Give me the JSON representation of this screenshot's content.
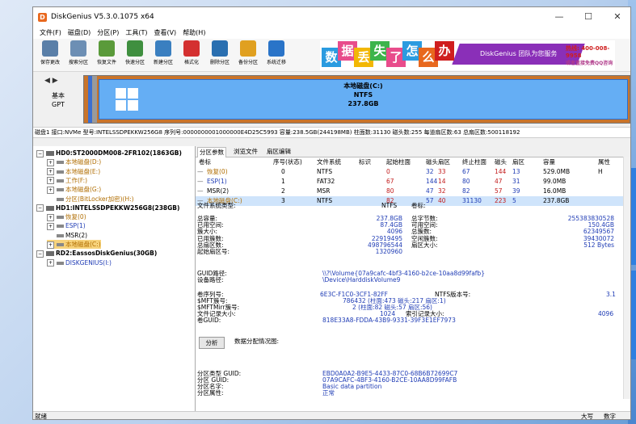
{
  "window": {
    "title": "DiskGenius V5.3.0.1075 x64",
    "minimize": "—",
    "maximize": "☐",
    "close": "✕"
  },
  "menu": [
    "文件(F)",
    "磁盘(D)",
    "分区(P)",
    "工具(T)",
    "查看(V)",
    "帮助(H)"
  ],
  "toolbar": [
    {
      "label": "保存更改",
      "icon": "save-icon",
      "color": "#5a7fa8"
    },
    {
      "label": "搜索分区",
      "icon": "search-icon",
      "color": "#6d8fb4"
    },
    {
      "label": "恢复文件",
      "icon": "recover-icon",
      "color": "#5a9a3a"
    },
    {
      "label": "快速分区",
      "icon": "quick-partition-icon",
      "color": "#3f8f3f"
    },
    {
      "label": "新建分区",
      "icon": "new-partition-icon",
      "color": "#3a7fc0"
    },
    {
      "label": "格式化",
      "icon": "format-icon",
      "color": "#d43030"
    },
    {
      "label": "删除分区",
      "icon": "delete-icon",
      "color": "#2a6fb0"
    },
    {
      "label": "备份分区",
      "icon": "backup-icon",
      "color": "#e0a020"
    },
    {
      "label": "系统迁移",
      "icon": "migrate-icon",
      "color": "#2a74c8"
    }
  ],
  "banner": {
    "chars": [
      "数",
      "据",
      "丢",
      "失",
      "了",
      "怎",
      "么",
      "办"
    ],
    "char_colors": [
      "#2a9be0",
      "#e84c8b",
      "#f2b705",
      "#3cb44b",
      "#e84c8b",
      "#2a9be0",
      "#e8681e",
      "#cf1e1e"
    ],
    "slogan": "DiskGenius 团队为您服务",
    "phone": "热线: 400-008-9958",
    "qq": "或者直接免费QQ咨询"
  },
  "disk_map": {
    "nav": "◀ ▶",
    "basic": "基本",
    "gpt": "GPT",
    "partition_name": "本地磁盘(C:)",
    "fs": "NTFS",
    "size": "237.8GB"
  },
  "disk_info": "磁盘1 接口:NVMe  型号:INTELSSDPEKKW256G8  序列号:0000000001000000E4D25C5993  容量:238.5GB(244198MB)  柱面数:31130  磁头数:255  每道扇区数:63  总扇区数:500118192",
  "tree": [
    {
      "indent": 0,
      "exp": "−",
      "type": "hdd",
      "label": "HD0:ST2000DM008-2FR102(1863GB)",
      "style": "bold"
    },
    {
      "indent": 1,
      "exp": "+",
      "type": "part",
      "label": "本地磁盘(D:)",
      "style": "orange"
    },
    {
      "indent": 1,
      "exp": "+",
      "type": "part",
      "label": "本地磁盘(E:)",
      "style": "orange"
    },
    {
      "indent": 1,
      "exp": "+",
      "type": "part",
      "label": "工作(F:)",
      "style": "orange"
    },
    {
      "indent": 1,
      "exp": "+",
      "type": "part",
      "label": "本地磁盘(G:)",
      "style": "orange"
    },
    {
      "indent": 1,
      "exp": "",
      "type": "part",
      "label": "分区(BitLocker加密)(H:)",
      "style": "orange"
    },
    {
      "indent": 0,
      "exp": "−",
      "type": "hdd",
      "label": "HD1:INTELSSDPEKKW256G8(238GB)",
      "style": "bold"
    },
    {
      "indent": 1,
      "exp": "+",
      "type": "part",
      "label": "恢复(0)",
      "style": "orange"
    },
    {
      "indent": 1,
      "exp": "+",
      "type": "part",
      "label": "ESP(1)",
      "style": "blue"
    },
    {
      "indent": 1,
      "exp": "",
      "type": "part",
      "label": "MSR(2)",
      "style": "plain"
    },
    {
      "indent": 1,
      "exp": "+",
      "type": "part",
      "label": "本地磁盘(C:)",
      "style": "orange",
      "selected": true
    },
    {
      "indent": 0,
      "exp": "−",
      "type": "hdd",
      "label": "RD2:EassosDiskGenius(30GB)",
      "style": "bold"
    },
    {
      "indent": 1,
      "exp": "+",
      "type": "part",
      "label": "DISKGENIUS(I:)",
      "style": "blue"
    }
  ],
  "tabs": [
    "分区参数",
    "浏览文件",
    "扇区编辑"
  ],
  "ptable": {
    "headers": [
      "卷标",
      "序号(状态)",
      "文件系统",
      "标识",
      "起始柱面",
      "磁头",
      "扇区",
      "终止柱面",
      "磁头",
      "扇区",
      "容量",
      "属性"
    ],
    "rows": [
      {
        "name": "恢复(0)",
        "seq": "0",
        "fs": "NTFS",
        "id": "",
        "sc": "0",
        "sh": "32",
        "ss": "33",
        "ec": "67",
        "eh": "144",
        "es": "13",
        "cap": "529.0MB",
        "attr": "H",
        "color": "orange"
      },
      {
        "name": "ESP(1)",
        "seq": "1",
        "fs": "FAT32",
        "id": "",
        "sc": "67",
        "sh": "144",
        "ss": "14",
        "ec": "80",
        "eh": "47",
        "es": "31",
        "cap": "99.0MB",
        "attr": "",
        "color": "blue"
      },
      {
        "name": "MSR(2)",
        "seq": "2",
        "fs": "MSR",
        "id": "",
        "sc": "80",
        "sh": "47",
        "ss": "32",
        "ec": "82",
        "eh": "57",
        "es": "39",
        "cap": "16.0MB",
        "attr": "",
        "color": "plain"
      },
      {
        "name": "本地磁盘(C:)",
        "seq": "3",
        "fs": "NTFS",
        "id": "",
        "sc": "82",
        "sh": "57",
        "ss": "40",
        "ec": "31130",
        "eh": "223",
        "es": "5",
        "cap": "237.8GB",
        "attr": "",
        "color": "orange",
        "selected": true
      }
    ]
  },
  "details": {
    "fs_type_label": "文件系统类型:",
    "fs_type_value": "NTFS",
    "volume_label": "卷标:",
    "left": [
      [
        "总容量:",
        "237.8GB"
      ],
      [
        "已用空间:",
        "87.4GB"
      ],
      [
        "簇大小:",
        "4096"
      ],
      [
        "已用簇数:",
        "22919495"
      ],
      [
        "总扇区数:",
        "498796544"
      ],
      [
        "起始扇区号:",
        "1320960"
      ]
    ],
    "right": [
      [
        "总字节数:",
        "255383830528"
      ],
      [
        "可用空间:",
        "150.4GB"
      ],
      [
        "总簇数:",
        "62349567"
      ],
      [
        "空闲簇数:",
        "39430072"
      ],
      [
        "扇区大小:",
        "512 Bytes"
      ]
    ],
    "guid_path_label": "GUID路径:",
    "guid_path": "\\\\?\\Volume{07a9cafc-4bf3-4160-b2ce-10aa8d99fafb}",
    "device_path_label": "设备路径:",
    "device_path": "\\Device\\HarddiskVolume9",
    "vol_serial_label": "卷序列号:",
    "vol_serial": "6E3C-F1C0-3CF1-82FF",
    "ntfs_ver_label": "NTFS版本号:",
    "ntfs_ver": "3.1",
    "mft_label": "$MFT簇号:",
    "mft": "786432 (柱面:473 磁头:217 扇区:1)",
    "mftmirr_label": "$MFTMirr簇号:",
    "mftmirr": "2 (柱面:82 磁头:57 扇区:56)",
    "rec_size_label": "文件记录大小:",
    "rec_size": "1024",
    "idx_size_label": "索引记录大小:",
    "idx_size": "4096",
    "vol_guid_label": "卷GUID:",
    "vol_guid": "818E33A8-FDDA-43B9-9331-39F3E1EF7973",
    "analyze_btn": "分析",
    "analyze_text": "数据分配情况图:",
    "ptype_guid_label": "分区类型 GUID:",
    "ptype_guid": "EBD0A0A2-B9E5-4433-87C0-68B6B72699C7",
    "p_guid_label": "分区 GUID:",
    "p_guid": "07A9CAFC-4BF3-4160-B2CE-10AA8D99FAFB",
    "p_name_label": "分区名字:",
    "p_name": "Basic data partition",
    "p_attr_label": "分区属性:",
    "p_attr": "正常"
  },
  "status": {
    "left": "就绪",
    "caps": "大写",
    "num": "数字"
  }
}
